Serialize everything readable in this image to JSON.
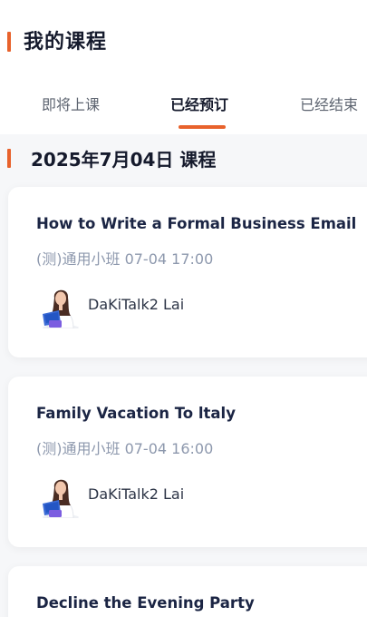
{
  "header": {
    "title": "我的课程"
  },
  "tabs": [
    {
      "label": "即将上课",
      "active": false
    },
    {
      "label": "已经预订",
      "active": true
    },
    {
      "label": "已经结束",
      "active": false
    }
  ],
  "section": {
    "title": "2025年7月04日 课程"
  },
  "courses": [
    {
      "title": "How to Write a Formal Business Email",
      "meta": "(测)通用小班 07-04 17:00",
      "teacher": "DaKiTalk2 Lai"
    },
    {
      "title": "Family Vacation To ltaly",
      "meta": "(测)通用小班 07-04 16:00",
      "teacher": "DaKiTalk2 Lai"
    },
    {
      "title": "Decline the Evening Party"
    }
  ],
  "colors": {
    "accent": "#e8622c",
    "title": "#1b2544",
    "meta": "#8d98ad"
  },
  "icons": {
    "teacher_avatar": "teacher-avatar-icon"
  }
}
